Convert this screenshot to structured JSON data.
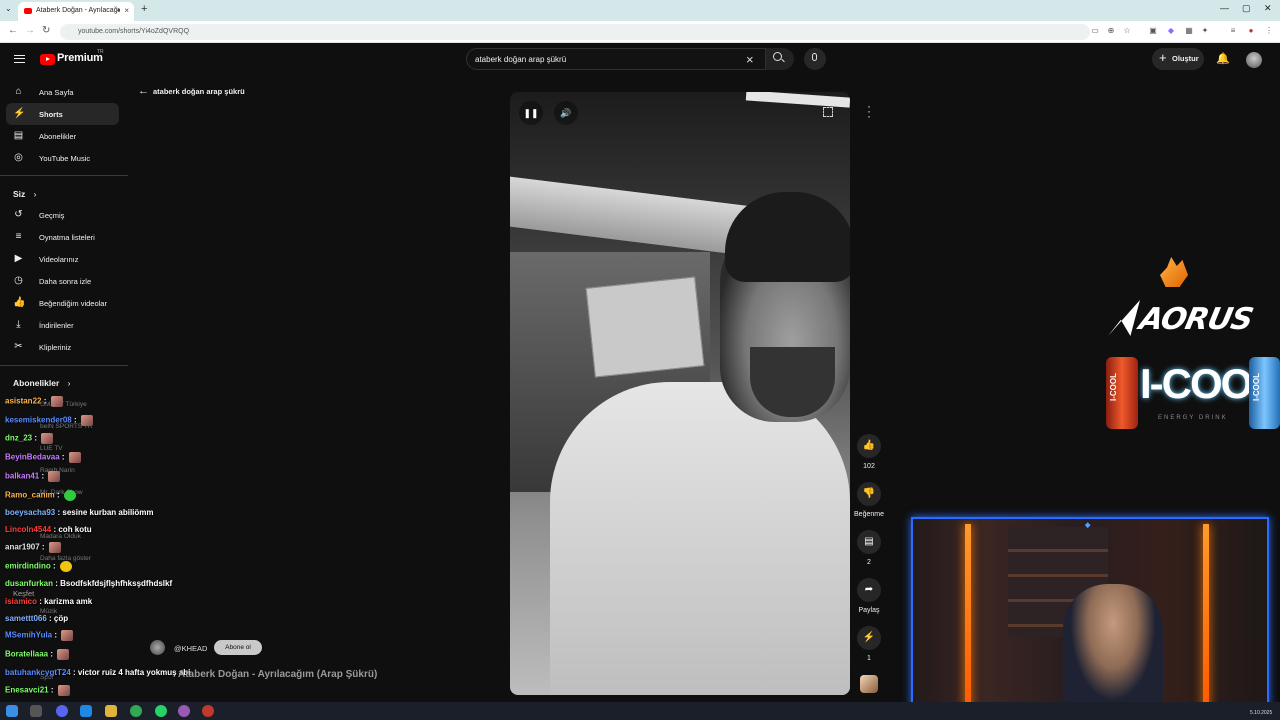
{
  "browser": {
    "tab_title": "Ataberk Doğan - Ayrılacağı",
    "tab_close": "×",
    "new_tab": "+",
    "url": "youtube.com/shorts/Yi4oZdQVRQQ",
    "window_controls": [
      "—",
      "▢",
      "✕"
    ]
  },
  "header": {
    "logo_text": "Premium",
    "logo_region": "TR",
    "search_query": "ataberk doğan arap şükrü",
    "create_label": "Oluştur"
  },
  "sidebar": {
    "main": [
      {
        "label": "Ana Sayfa",
        "icon": "home-icon",
        "glyph": "⌂"
      },
      {
        "label": "Shorts",
        "icon": "shorts-icon",
        "glyph": "⚡"
      },
      {
        "label": "Abonelikler",
        "icon": "subscriptions-icon",
        "glyph": "▤"
      },
      {
        "label": "YouTube Music",
        "icon": "music-icon",
        "glyph": "◎"
      }
    ],
    "you_heading": "Siz",
    "you": [
      {
        "label": "Geçmiş",
        "icon": "history-icon",
        "glyph": "↺"
      },
      {
        "label": "Oynatma listeleri",
        "icon": "playlists-icon",
        "glyph": "≡"
      },
      {
        "label": "Videolarınız",
        "icon": "your-videos-icon",
        "glyph": "▶"
      },
      {
        "label": "Daha sonra izle",
        "icon": "watch-later-icon",
        "glyph": "◷"
      },
      {
        "label": "Beğendiğim videolar",
        "icon": "liked-icon",
        "glyph": "👍"
      },
      {
        "label": "İndirilenler",
        "icon": "downloads-icon",
        "glyph": "⤓"
      },
      {
        "label": "Klipleriniz",
        "icon": "clips-icon",
        "glyph": "✂"
      }
    ],
    "subs_heading": "Abonelikler",
    "faint_items": [
      "GMACY Türkiye",
      "beIN SPORTS TR",
      "LUE TV",
      "Ragıb Narin",
      "Mr. Dark Show",
      "Madara Olduk",
      "Daha fazla göster",
      "Keşfet",
      "Müzik",
      "Spor"
    ]
  },
  "back_link": "ataberk doğan arap şükrü",
  "video": {
    "title": "Ataberk Doğan - Ayrılacağım (Arap Şükrü)",
    "channel": "@KHEAD",
    "subscribe_label": "Abone ol"
  },
  "actions": {
    "like_count": "102",
    "dislike_label": "Beğenme",
    "comment_count": "2",
    "share_label": "Paylaş",
    "remix_count": "1"
  },
  "sponsors": {
    "aorus": "AORUS",
    "icool": "I-COOL",
    "icool_sub": "ENERGY DRINK",
    "can_label": "I-COOL"
  },
  "chat": [
    {
      "user": "asistan22",
      "msg": "",
      "color": "#ffb347",
      "emote": true
    },
    {
      "user": "kesemiskender08",
      "msg": "",
      "color": "#5b8cff",
      "emote": true
    },
    {
      "user": "dnz_23",
      "msg": "",
      "color": "#7fff6b",
      "emote": true
    },
    {
      "user": "BeyinBedavaa",
      "msg": "",
      "color": "#c77dff",
      "emote": true
    },
    {
      "user": "balkan41",
      "msg": "",
      "color": "#c77dff",
      "emote": true
    },
    {
      "user": "Ramo_canım",
      "msg": "",
      "color": "#ffb347",
      "emote": true
    },
    {
      "user": "boeysacha93",
      "msg": "sesine kurban abiliömm",
      "color": "#7fb3ff",
      "emote": false
    },
    {
      "user": "Lincoln4544",
      "msg": "coh kotu",
      "color": "#ff3b3b",
      "emote": false
    },
    {
      "user": "anar1907",
      "msg": "",
      "color": "#e0e0e0",
      "emote": true
    },
    {
      "user": "emirdindino",
      "msg": "",
      "color": "#7fff6b",
      "emote": true
    },
    {
      "user": "dusanfurkan",
      "msg": "Bsodfskfdsjflşhfhksşdfhdslkf",
      "color": "#7fff6b",
      "emote": false
    },
    {
      "user": "isiamico",
      "msg": "karizma amk",
      "color": "#ff3b3b",
      "emote": false
    },
    {
      "user": "samettt066",
      "msg": "çöp",
      "color": "#7fb3ff",
      "emote": false
    },
    {
      "user": "MSemihYula",
      "msg": "",
      "color": "#5b8cff",
      "emote": true
    },
    {
      "user": "Boratellaaa",
      "msg": "",
      "color": "#7fff6b",
      "emote": true
    },
    {
      "user": "batuhankcygtT24",
      "msg": "victor ruiz 4 hafta yokmuş abi",
      "color": "#5b8cff",
      "emote": false
    },
    {
      "user": "Enesavci21",
      "msg": "",
      "color": "#7fff6b",
      "emote": true
    }
  ],
  "taskbar": {
    "date": "5.10.2025"
  }
}
